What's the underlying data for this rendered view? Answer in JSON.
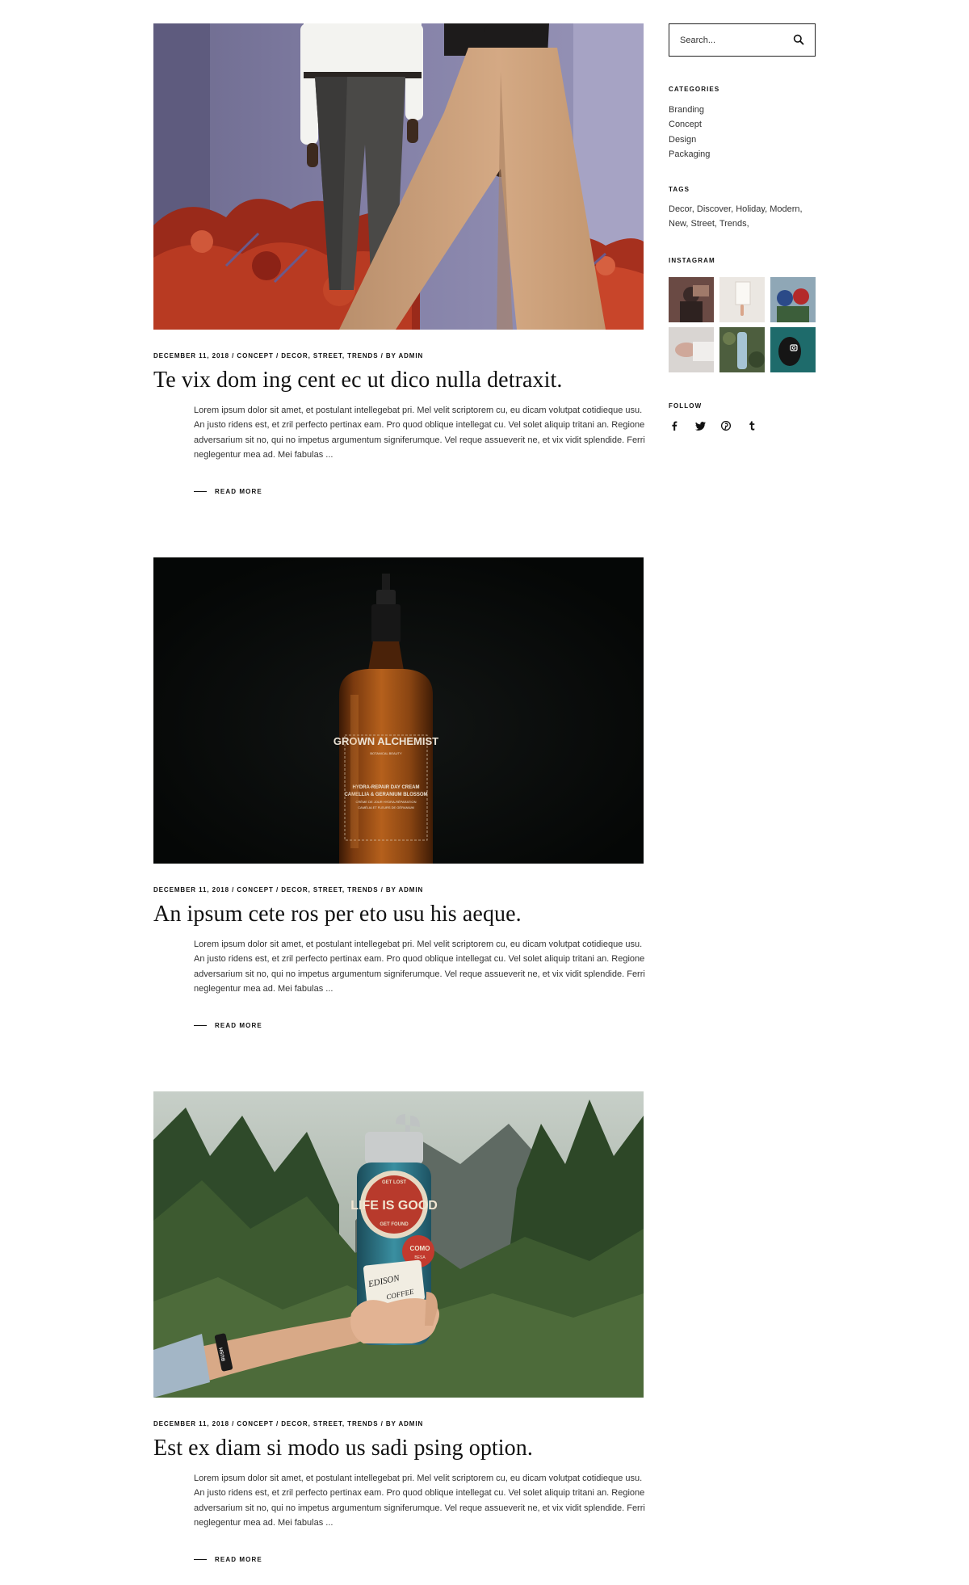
{
  "posts": [
    {
      "meta": {
        "date": "December 11, 2018",
        "category": "Concept",
        "tags": [
          "Decor",
          "Street",
          "Trends"
        ],
        "author_prefix": "By",
        "author": "Admin"
      },
      "title": "Te vix dom ing cent ec ut dico nulla detraxit.",
      "excerpt": "Lorem ipsum dolor sit amet, et postulant intellegebat pri. Mel velit scriptorem cu, eu dicam volutpat cotidieque usu. An justo ridens est, et zril perfecto pertinax eam. Pro quod oblique intellegat cu. Vel solet aliquip tritani an. Regione adversarium sit no, qui no impetus argumentum signiferumque. Vel reque assueverit ne, et vix vidit splendide. Ferri neglegentur mea ad. Mei fabulas ...",
      "read_more": "Read More"
    },
    {
      "meta": {
        "date": "December 11, 2018",
        "category": "Concept",
        "tags": [
          "Decor",
          "Street",
          "Trends"
        ],
        "author_prefix": "By",
        "author": "Admin"
      },
      "title": "An ipsum cete ros per eto usu his aeque.",
      "excerpt": "Lorem ipsum dolor sit amet, et postulant intellegebat pri. Mel velit scriptorem cu, eu dicam volutpat cotidieque usu. An justo ridens est, et zril perfecto pertinax eam. Pro quod oblique intellegat cu. Vel solet aliquip tritani an. Regione adversarium sit no, qui no impetus argumentum signiferumque. Vel reque assueverit ne, et vix vidit splendide. Ferri neglegentur mea ad. Mei fabulas ...",
      "read_more": "Read More",
      "image_text": {
        "brand": "GROWN ALCHEMIST",
        "sub": "BOTANICAL BEAUTY",
        "line1": "HYDRA-REPAIR DAY CREAM",
        "line2": "CAMELLIA & GERANIUM BLOSSOM",
        "line3": "CRÈME DE JOUR HYDRA-RÉPARATION",
        "line4": "CAMÉLIA ET FLEURS DE GÉRANIUM"
      }
    },
    {
      "meta": {
        "date": "December 11, 2018",
        "category": "Concept",
        "tags": [
          "Decor",
          "Street",
          "Trends"
        ],
        "author_prefix": "By",
        "author": "Admin"
      },
      "title": "Est ex diam si modo us sadi psing option.",
      "excerpt": "Lorem ipsum dolor sit amet, et postulant intellegebat pri. Mel velit scriptorem cu, eu dicam volutpat cotidieque usu. An justo ridens est, et zril perfecto pertinax eam. Pro quod oblique intellegat cu. Vel solet aliquip tritani an. Regione adversarium sit no, qui no impetus argumentum signiferumque. Vel reque assueverit ne, et vix vidit splendide. Ferri neglegentur mea ad. Mei fabulas ...",
      "read_more": "Read More",
      "image_text": {
        "top": "GET LOST",
        "main": "LIFE IS GOOD",
        "bottom": "GET FOUND",
        "side": "COMO",
        "side2": "BESA",
        "sticker": "EDISON",
        "sticker2": "COFFEE",
        "band": "BUSH"
      }
    }
  ],
  "sidebar": {
    "search": {
      "placeholder": "Search..."
    },
    "categories": {
      "title": "Categories",
      "items": [
        "Branding",
        "Concept",
        "Design",
        "Packaging"
      ]
    },
    "tags": {
      "title": "Tags",
      "items": [
        "Decor",
        "Discover",
        "Holiday",
        "Modern",
        "New",
        "Street",
        "Trends"
      ]
    },
    "instagram": {
      "title": "Instagram"
    },
    "follow": {
      "title": "Follow",
      "icons": [
        "facebook-icon",
        "twitter-icon",
        "pinterest-icon",
        "tumblr-icon"
      ]
    }
  },
  "colors": {
    "text": "#222222",
    "heading": "#111111",
    "body": "#333333",
    "background": "#ffffff"
  }
}
